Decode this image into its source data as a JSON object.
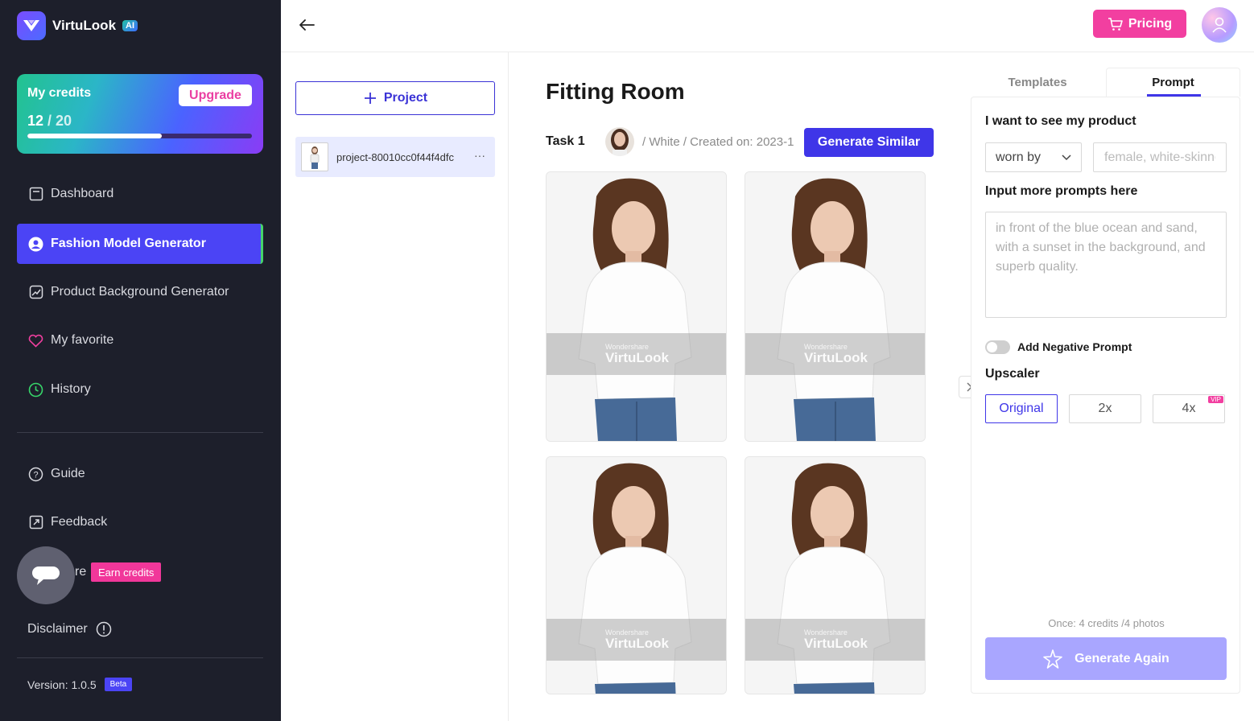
{
  "brand": {
    "name": "VirtuLook",
    "badge": "AI"
  },
  "credits": {
    "title": "My credits",
    "used": "12",
    "total": "/ 20",
    "fraction": 0.6,
    "upgrade_label": "Upgrade"
  },
  "nav": {
    "dashboard": "Dashboard",
    "fashion": "Fashion Model Generator",
    "product_bg": "Product Background Generator",
    "favorite": "My favorite",
    "history": "History",
    "guide": "Guide",
    "feedback": "Feedback",
    "share_partial": "re",
    "earn_credits": "Earn credits",
    "disclaimer": "Disclaimer",
    "version": "Version: 1.0.5",
    "beta": "Beta"
  },
  "topbar": {
    "pricing_label": "Pricing"
  },
  "projects": {
    "new_label": "Project",
    "items": [
      {
        "name": "project-80010cc0f44f4dfc",
        "more": "···"
      }
    ]
  },
  "main": {
    "title": "Fitting Room",
    "task_label": "Task 1",
    "task_meta": "/ White / Created on: 2023-1",
    "generate_similar": "Generate Similar",
    "watermark_brand": "Wondershare",
    "watermark_name": "VirtuLook"
  },
  "right_panel": {
    "tab_templates": "Templates",
    "tab_prompt": "Prompt",
    "see_product_label": "I want to see my product",
    "worn_by": "worn by",
    "desc_placeholder": "female, white-skinned",
    "more_prompts_label": "Input more prompts here",
    "prompt_placeholder": "in front of the blue ocean and sand, with a sunset in the background, and superb quality.",
    "negative_label": "Add Negative Prompt",
    "upscaler_label": "Upscaler",
    "upscale_options": [
      "Original",
      "2x",
      "4x"
    ],
    "vip": "VIP",
    "once_text": "Once: 4 credits /4 photos",
    "generate_again": "Generate Again"
  },
  "colors": {
    "accent": "#3f36e8",
    "pink": "#f23fa0",
    "sidebar": "#1d1f2b"
  }
}
